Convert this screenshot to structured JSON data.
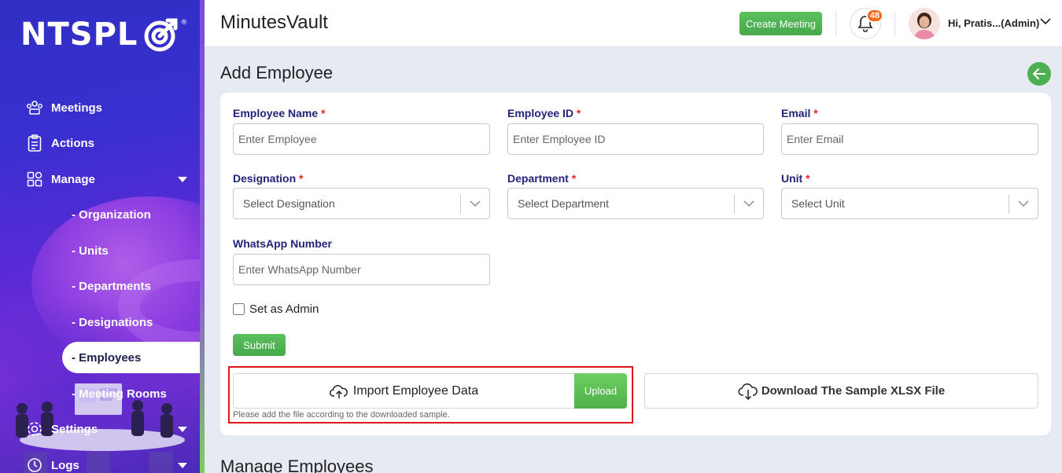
{
  "sidebar": {
    "logo_text": "NTSPL",
    "logo_reg": "®",
    "items": [
      {
        "label": "Meetings",
        "icon": "meetings-icon"
      },
      {
        "label": "Actions",
        "icon": "clipboard-icon"
      },
      {
        "label": "Manage",
        "icon": "grid-icon"
      }
    ],
    "sub_items": [
      "- Organization",
      "- Units",
      "- Departments",
      "- Designations",
      "- Employees",
      "- Meeting Rooms"
    ],
    "bottom_items": [
      {
        "label": "Settings",
        "icon": "gear-icon"
      },
      {
        "label": "Logs",
        "icon": "history-icon"
      }
    ]
  },
  "header": {
    "app_title": "MinutesVault",
    "create_meeting": "Create Meeting",
    "notification_count": "48",
    "user_name": "Hi, Pratis...(Admin)"
  },
  "page": {
    "title": "Add Employee",
    "section_title": "Manage Employees"
  },
  "form": {
    "employee_name": {
      "label": "Employee Name",
      "placeholder": "Enter Employee"
    },
    "employee_id": {
      "label": "Employee ID",
      "placeholder": "Enter Employee ID"
    },
    "email": {
      "label": "Email",
      "placeholder": "Enter Email"
    },
    "designation": {
      "label": "Designation",
      "placeholder": "Select Designation"
    },
    "department": {
      "label": "Department",
      "placeholder": "Select Department"
    },
    "unit": {
      "label": "Unit",
      "placeholder": "Select Unit"
    },
    "whatsapp": {
      "label": "WhatsApp Number",
      "placeholder": "Enter WhatsApp Number"
    },
    "required_mark": "*",
    "set_admin": "Set as Admin",
    "submit": "Submit"
  },
  "import": {
    "label": "Import Employee Data",
    "upload": "Upload",
    "hint": "Please add the file according to the downloaded sample.",
    "download": "Download The Sample XLSX File"
  },
  "colors": {
    "accent_green": "#4caf50",
    "label_navy": "#23237a",
    "badge_orange": "#f26b1d",
    "highlight_red": "#e01616"
  }
}
